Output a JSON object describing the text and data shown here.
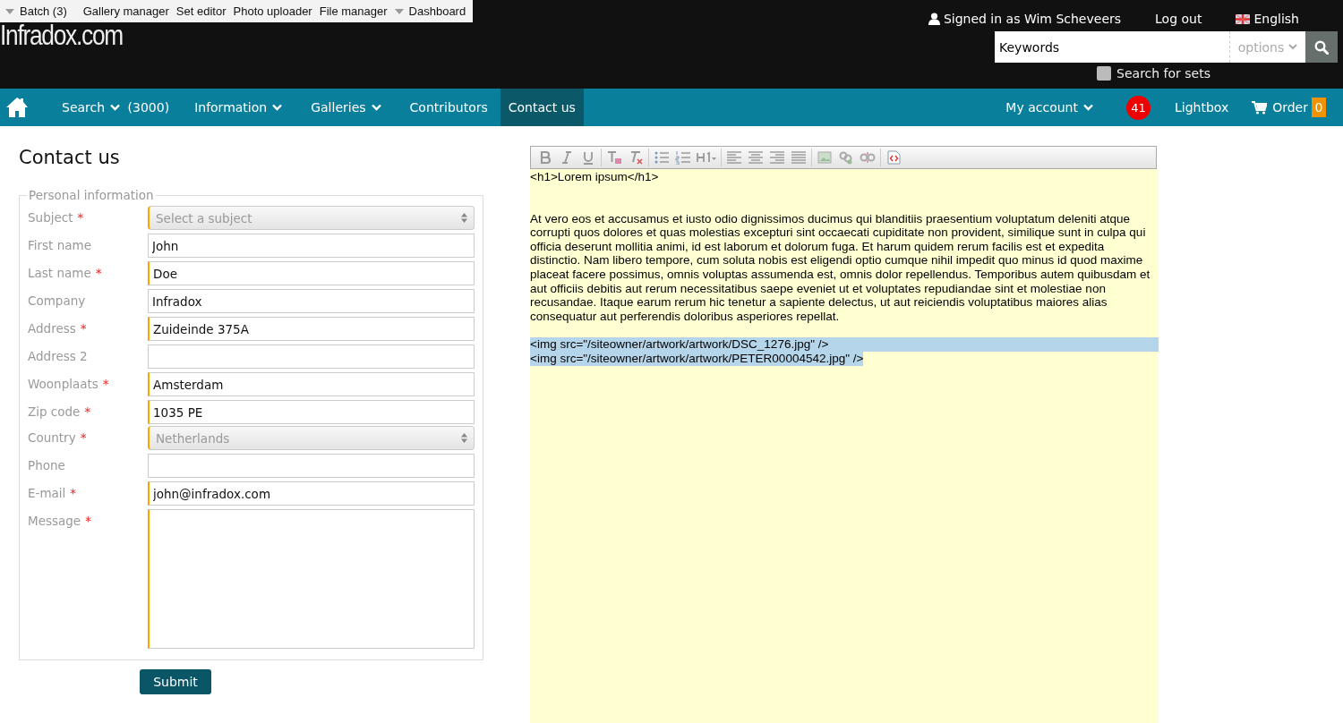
{
  "admin_bar": {
    "items": [
      {
        "label": "Batch (3)",
        "dropdown": true
      },
      {
        "label": "Gallery manager",
        "dropdown": false
      },
      {
        "label": "Set editor",
        "dropdown": false
      },
      {
        "label": "Photo uploader",
        "dropdown": false
      },
      {
        "label": "File manager",
        "dropdown": false
      },
      {
        "label": "Dashboard",
        "dropdown": true
      }
    ]
  },
  "header": {
    "logo": "Infradox.com",
    "signed_in": "Signed in as Wim Scheveers",
    "logout": "Log out",
    "language": "English",
    "search": {
      "value": "Keywords",
      "options": "options",
      "sets_label": "Search for sets",
      "sets_checked": false
    }
  },
  "nav": {
    "items": [
      {
        "label": "Search",
        "dropdown": true,
        "count": "(3000)",
        "selected": false
      },
      {
        "label": "Information",
        "dropdown": true,
        "selected": false
      },
      {
        "label": "Galleries",
        "dropdown": true,
        "selected": false
      },
      {
        "label": "Contributors",
        "dropdown": false,
        "selected": false
      },
      {
        "label": "Contact us",
        "dropdown": false,
        "selected": true
      }
    ],
    "right": {
      "account": "My account",
      "badge": "41",
      "lightbox": "Lightbox",
      "order": "Order",
      "order_count": "0"
    }
  },
  "page_title": "Contact us",
  "form": {
    "legend": "Personal information",
    "fields": [
      {
        "kind": "select",
        "label": "Subject",
        "required": true,
        "required_mark": "*",
        "placeholder": "Select a subject"
      },
      {
        "kind": "input",
        "label": "First name",
        "required": false,
        "value": "John"
      },
      {
        "kind": "input",
        "label": "Last name",
        "required": true,
        "required_mark": "*",
        "value": "Doe"
      },
      {
        "kind": "input",
        "label": "Company",
        "required": false,
        "value": "Infradox"
      },
      {
        "kind": "input",
        "label": "Address",
        "required": true,
        "required_mark": "*",
        "value": "Zuideinde 375A"
      },
      {
        "kind": "input",
        "label": "Address 2",
        "required": false
      },
      {
        "kind": "input",
        "label": "Woonplaats",
        "required": true,
        "required_mark": "*",
        "value": "Amsterdam"
      },
      {
        "kind": "input",
        "label": "Zip code",
        "required": true,
        "required_mark": "*",
        "value": "1035 PE"
      },
      {
        "kind": "select",
        "label": "Country",
        "required": true,
        "required_mark": "*",
        "value": "Netherlands"
      },
      {
        "kind": "input",
        "label": "Phone",
        "required": false
      },
      {
        "kind": "input",
        "label": "E-mail",
        "required": true,
        "required_mark": "*",
        "value": "john@infradox.com"
      },
      {
        "kind": "textarea",
        "label": "Message",
        "required": true,
        "required_mark": "*"
      }
    ],
    "submit": "Submit"
  },
  "editor": {
    "lines": [
      {
        "kind": "line",
        "text": "<h1>Lorem ipsum</h1>",
        "selected": false
      },
      {
        "kind": "blank"
      },
      {
        "kind": "paragraph",
        "text": "At vero eos et accusamus et iusto odio dignissimos ducimus qui blanditiis praesentium voluptatum deleniti atque corrupti quos dolores et quas molestias excepturi sint occaecati cupiditate non provident, similique sunt in culpa qui officia deserunt mollitia animi, id est laborum et dolorum fuga. Et harum quidem rerum facilis est et expedita distinctio. Nam libero tempore, cum soluta nobis est eligendi optio cumque nihil impedit quo minus id quod maxime placeat facere possimus, omnis voluptas assumenda est, omnis dolor repellendus. Temporibus autem quibusdam et aut officiis debitis aut rerum necessitatibus saepe eveniet ut et voluptates repudiandae sint et molestiae non recusandae. Itaque earum rerum hic tenetur a sapiente delectus, ut aut reiciendis voluptatibus maiores alias consequatur aut perferendis doloribus asperiores repellat.",
        "selected": false
      },
      {
        "kind": "line",
        "text": "<img src=\"/siteowner/artwork/artwork/DSC_1276.jpg\" />",
        "selected": true
      },
      {
        "kind": "line",
        "text": "<img src=\"/siteowner/artwork/artwork/PETER00004542.jpg\" />",
        "selected": true
      }
    ]
  }
}
